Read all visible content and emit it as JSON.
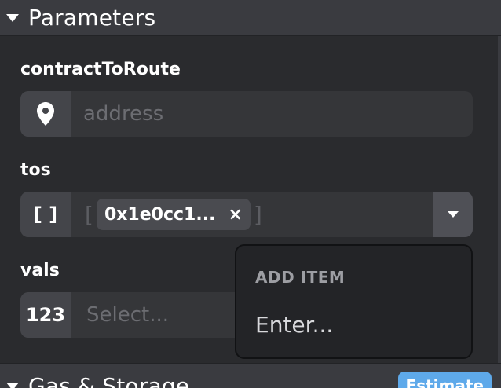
{
  "sections": {
    "parameters_title": "Parameters",
    "gas_title": "Gas & Storage",
    "estimate_label": "Estimate"
  },
  "fields": {
    "contract_to_route": {
      "label": "contractToRoute",
      "placeholder": "address",
      "icon": "map-pin-icon"
    },
    "tos": {
      "label": "tos",
      "addon": "[ ]",
      "bracket_open": "[",
      "bracket_close": "]",
      "chips": [
        "0x1e0cc1..."
      ],
      "chip_remove": "×"
    },
    "vals": {
      "label": "vals",
      "addon": "123",
      "placeholder": "Select..."
    }
  },
  "dropdown": {
    "heading": "ADD ITEM",
    "item": "Enter..."
  },
  "colors": {
    "background": "#2a2b2e",
    "header": "#3a3b40",
    "accent": "#5ea9ea"
  }
}
